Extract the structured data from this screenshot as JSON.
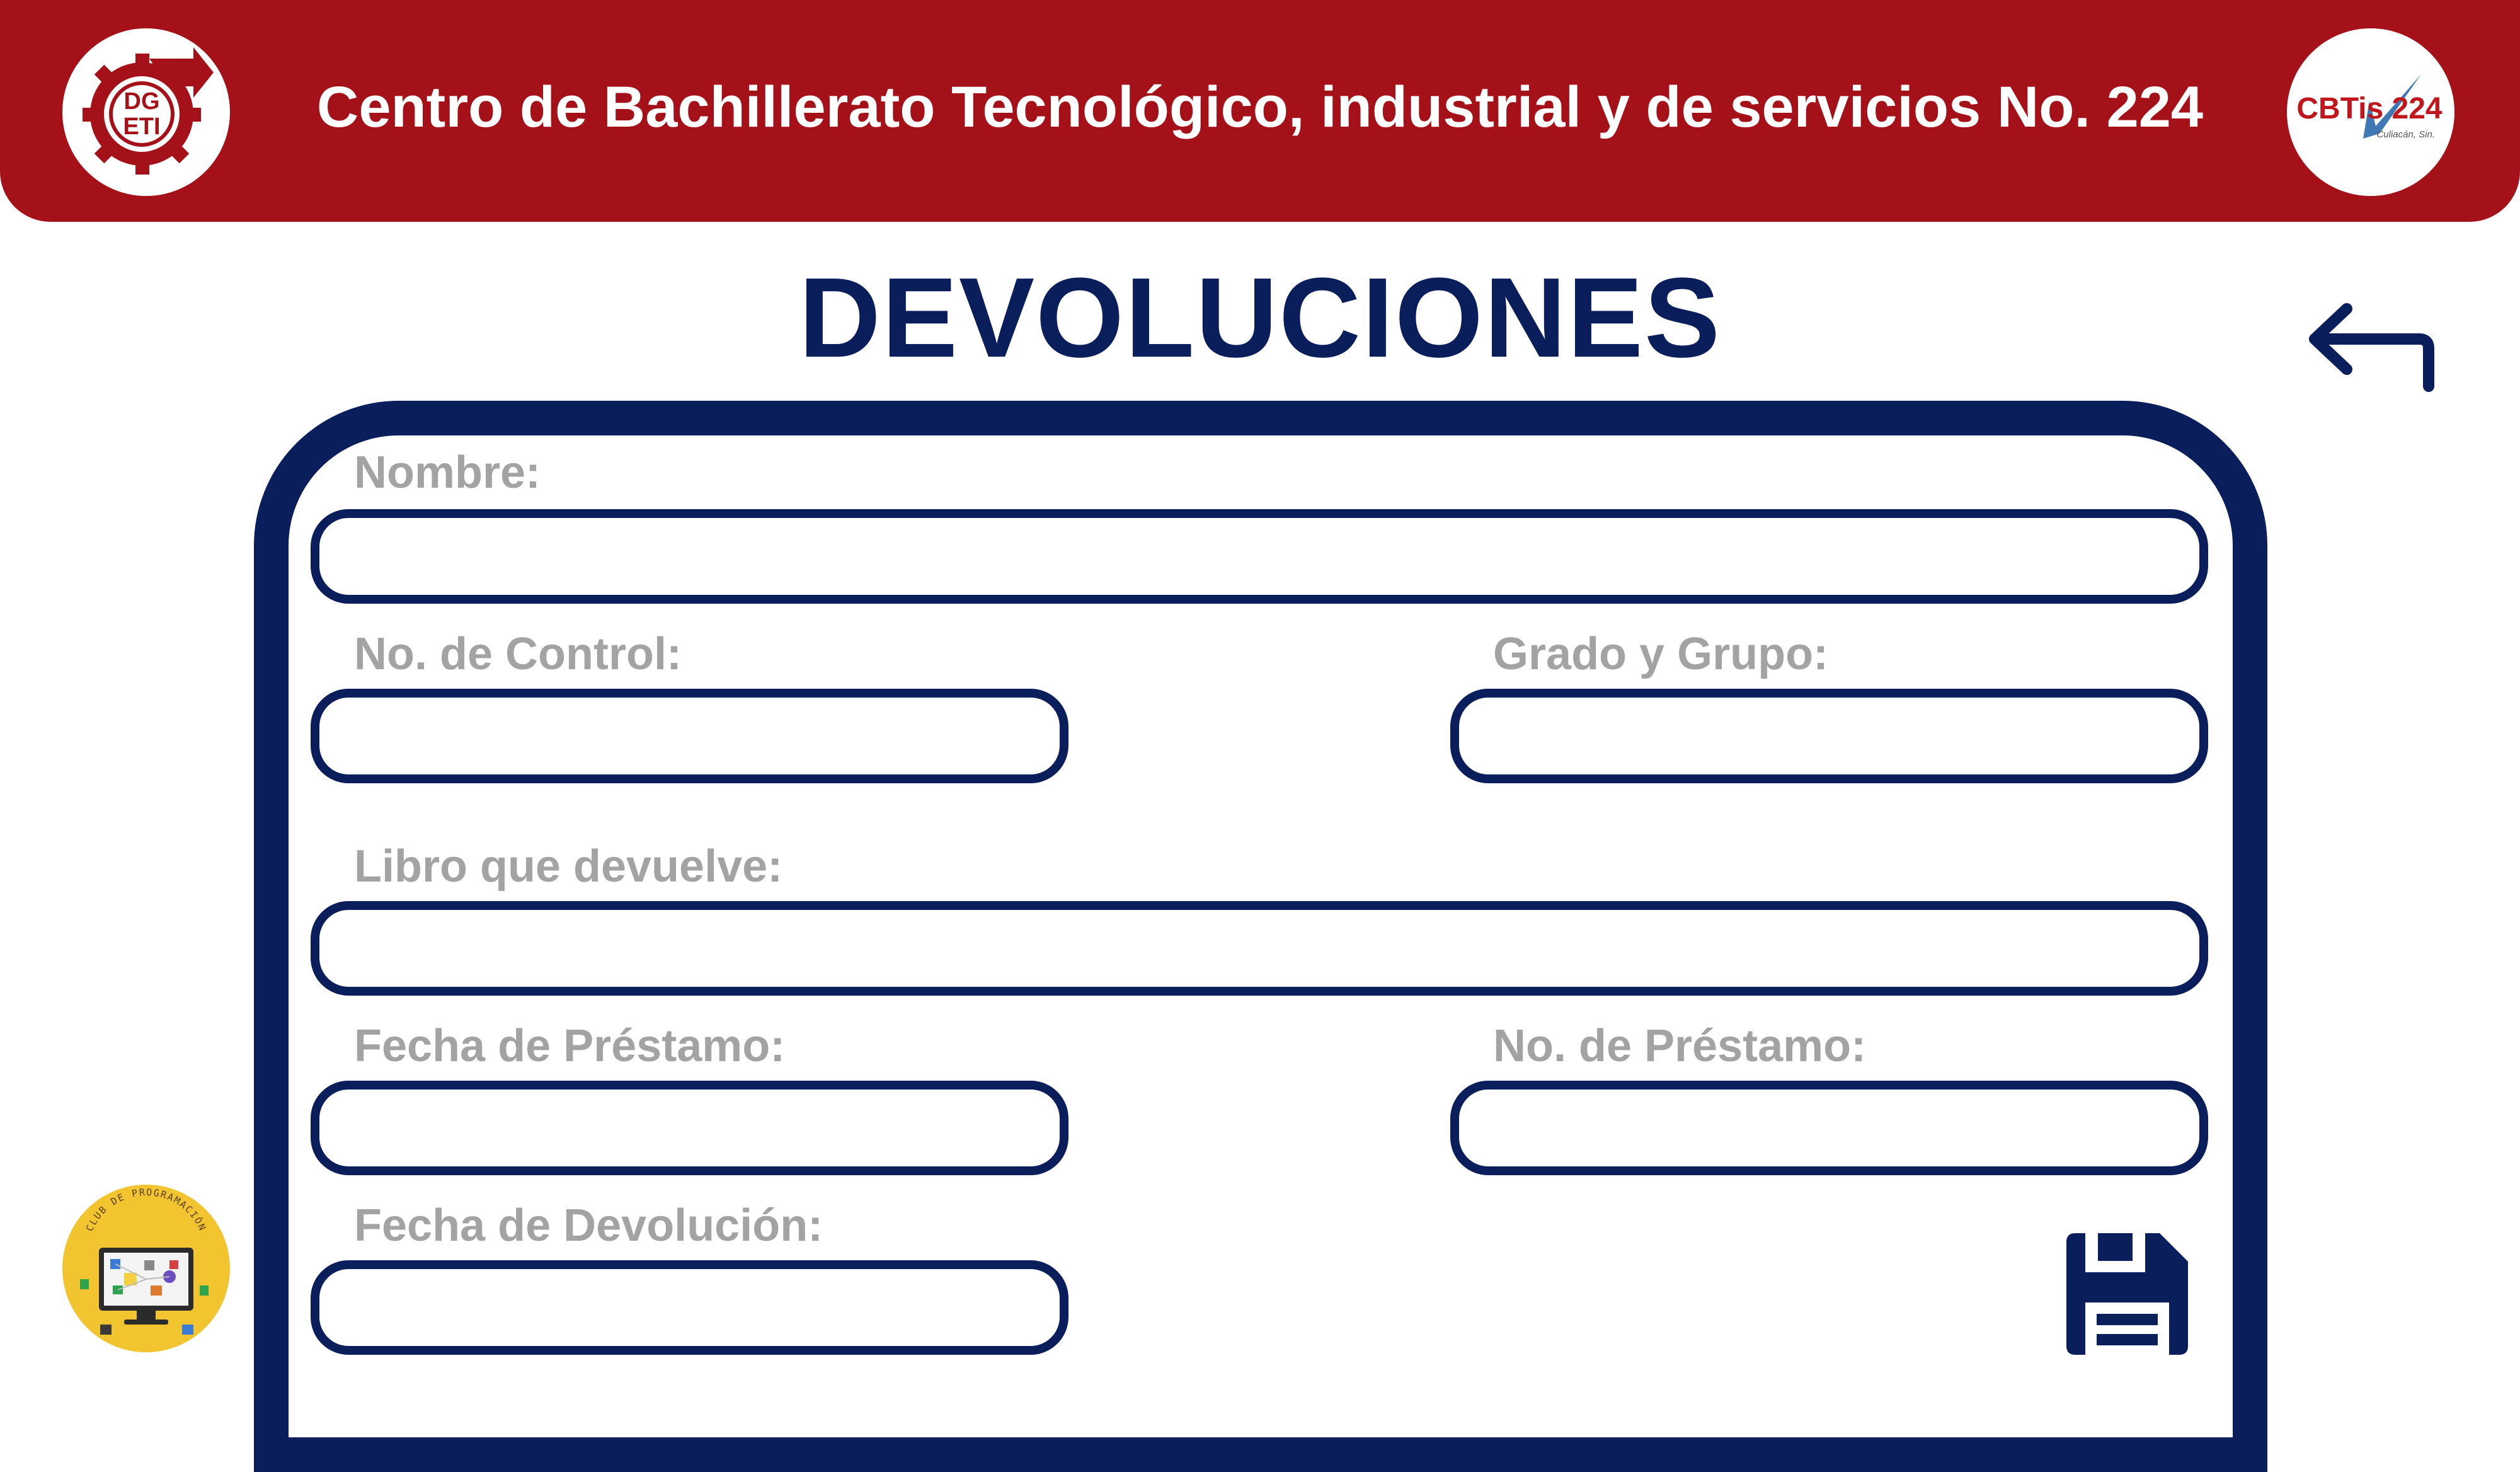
{
  "header": {
    "title": "Centro de Bachillerato Tecnológico, industrial y de servicios No. 224",
    "left_logo": {
      "icon": "dgeti-gear-logo",
      "text_top": "DG",
      "text_bottom": "ETI"
    },
    "right_logo": {
      "icon": "cbtis-224-logo",
      "text": "CBTis 224",
      "subtext": "Culiacán, Sin."
    }
  },
  "page": {
    "title": "DEVOLUCIONES",
    "back_icon": "back-arrow-icon",
    "save_icon": "floppy-disk-save-icon"
  },
  "form": {
    "nombre": {
      "label": "Nombre:",
      "value": ""
    },
    "no_control": {
      "label": "No. de Control:",
      "value": ""
    },
    "grado_grupo": {
      "label": "Grado y Grupo:",
      "value": ""
    },
    "libro": {
      "label": "Libro que devuelve:",
      "value": ""
    },
    "fecha_prestamo": {
      "label": "Fecha de Préstamo:",
      "value": ""
    },
    "no_prestamo": {
      "label": "No. de Préstamo:",
      "value": ""
    },
    "fecha_devolucion": {
      "label": "Fecha de Devolución:",
      "value": ""
    }
  },
  "footer": {
    "club_logo": {
      "icon": "club-de-programacion-logo",
      "text": "CLUB DE PROGRAMACIÓN"
    }
  },
  "colors": {
    "header_red": "#a51119",
    "navy": "#0b1e5c",
    "label_gray": "#a3a3a3",
    "club_yellow": "#f2c530"
  }
}
